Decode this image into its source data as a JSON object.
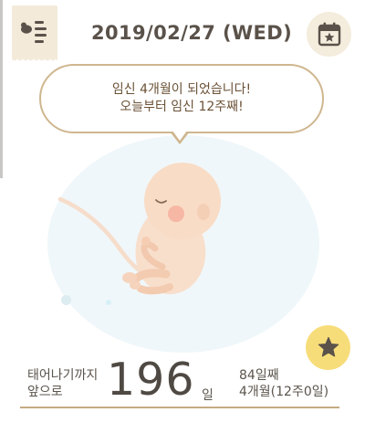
{
  "header": {
    "date": "2019/02/27 (WED)",
    "menu_icon": "baby-list-icon",
    "calendar_icon": "calendar-star-icon"
  },
  "bubble": {
    "line1": "임신 4개월이 되었습니다!",
    "line2": "오늘부터 임신 12주째!"
  },
  "illustration": {
    "subject": "fetus-illustration"
  },
  "countdown": {
    "label_line1": "태어나기까지",
    "label_line2": "앞으로",
    "days": "196",
    "unit": "일"
  },
  "progress": {
    "day_count": "84일째",
    "month_week": "4개월(12주0일)"
  },
  "fab": {
    "icon": "star-icon"
  },
  "colors": {
    "accent_beige": "#f3ead9",
    "bubble_border": "#cfb68f",
    "star_button": "#f7dd7a",
    "womb": "#f0f7fa",
    "text_dark": "#5a524a"
  }
}
